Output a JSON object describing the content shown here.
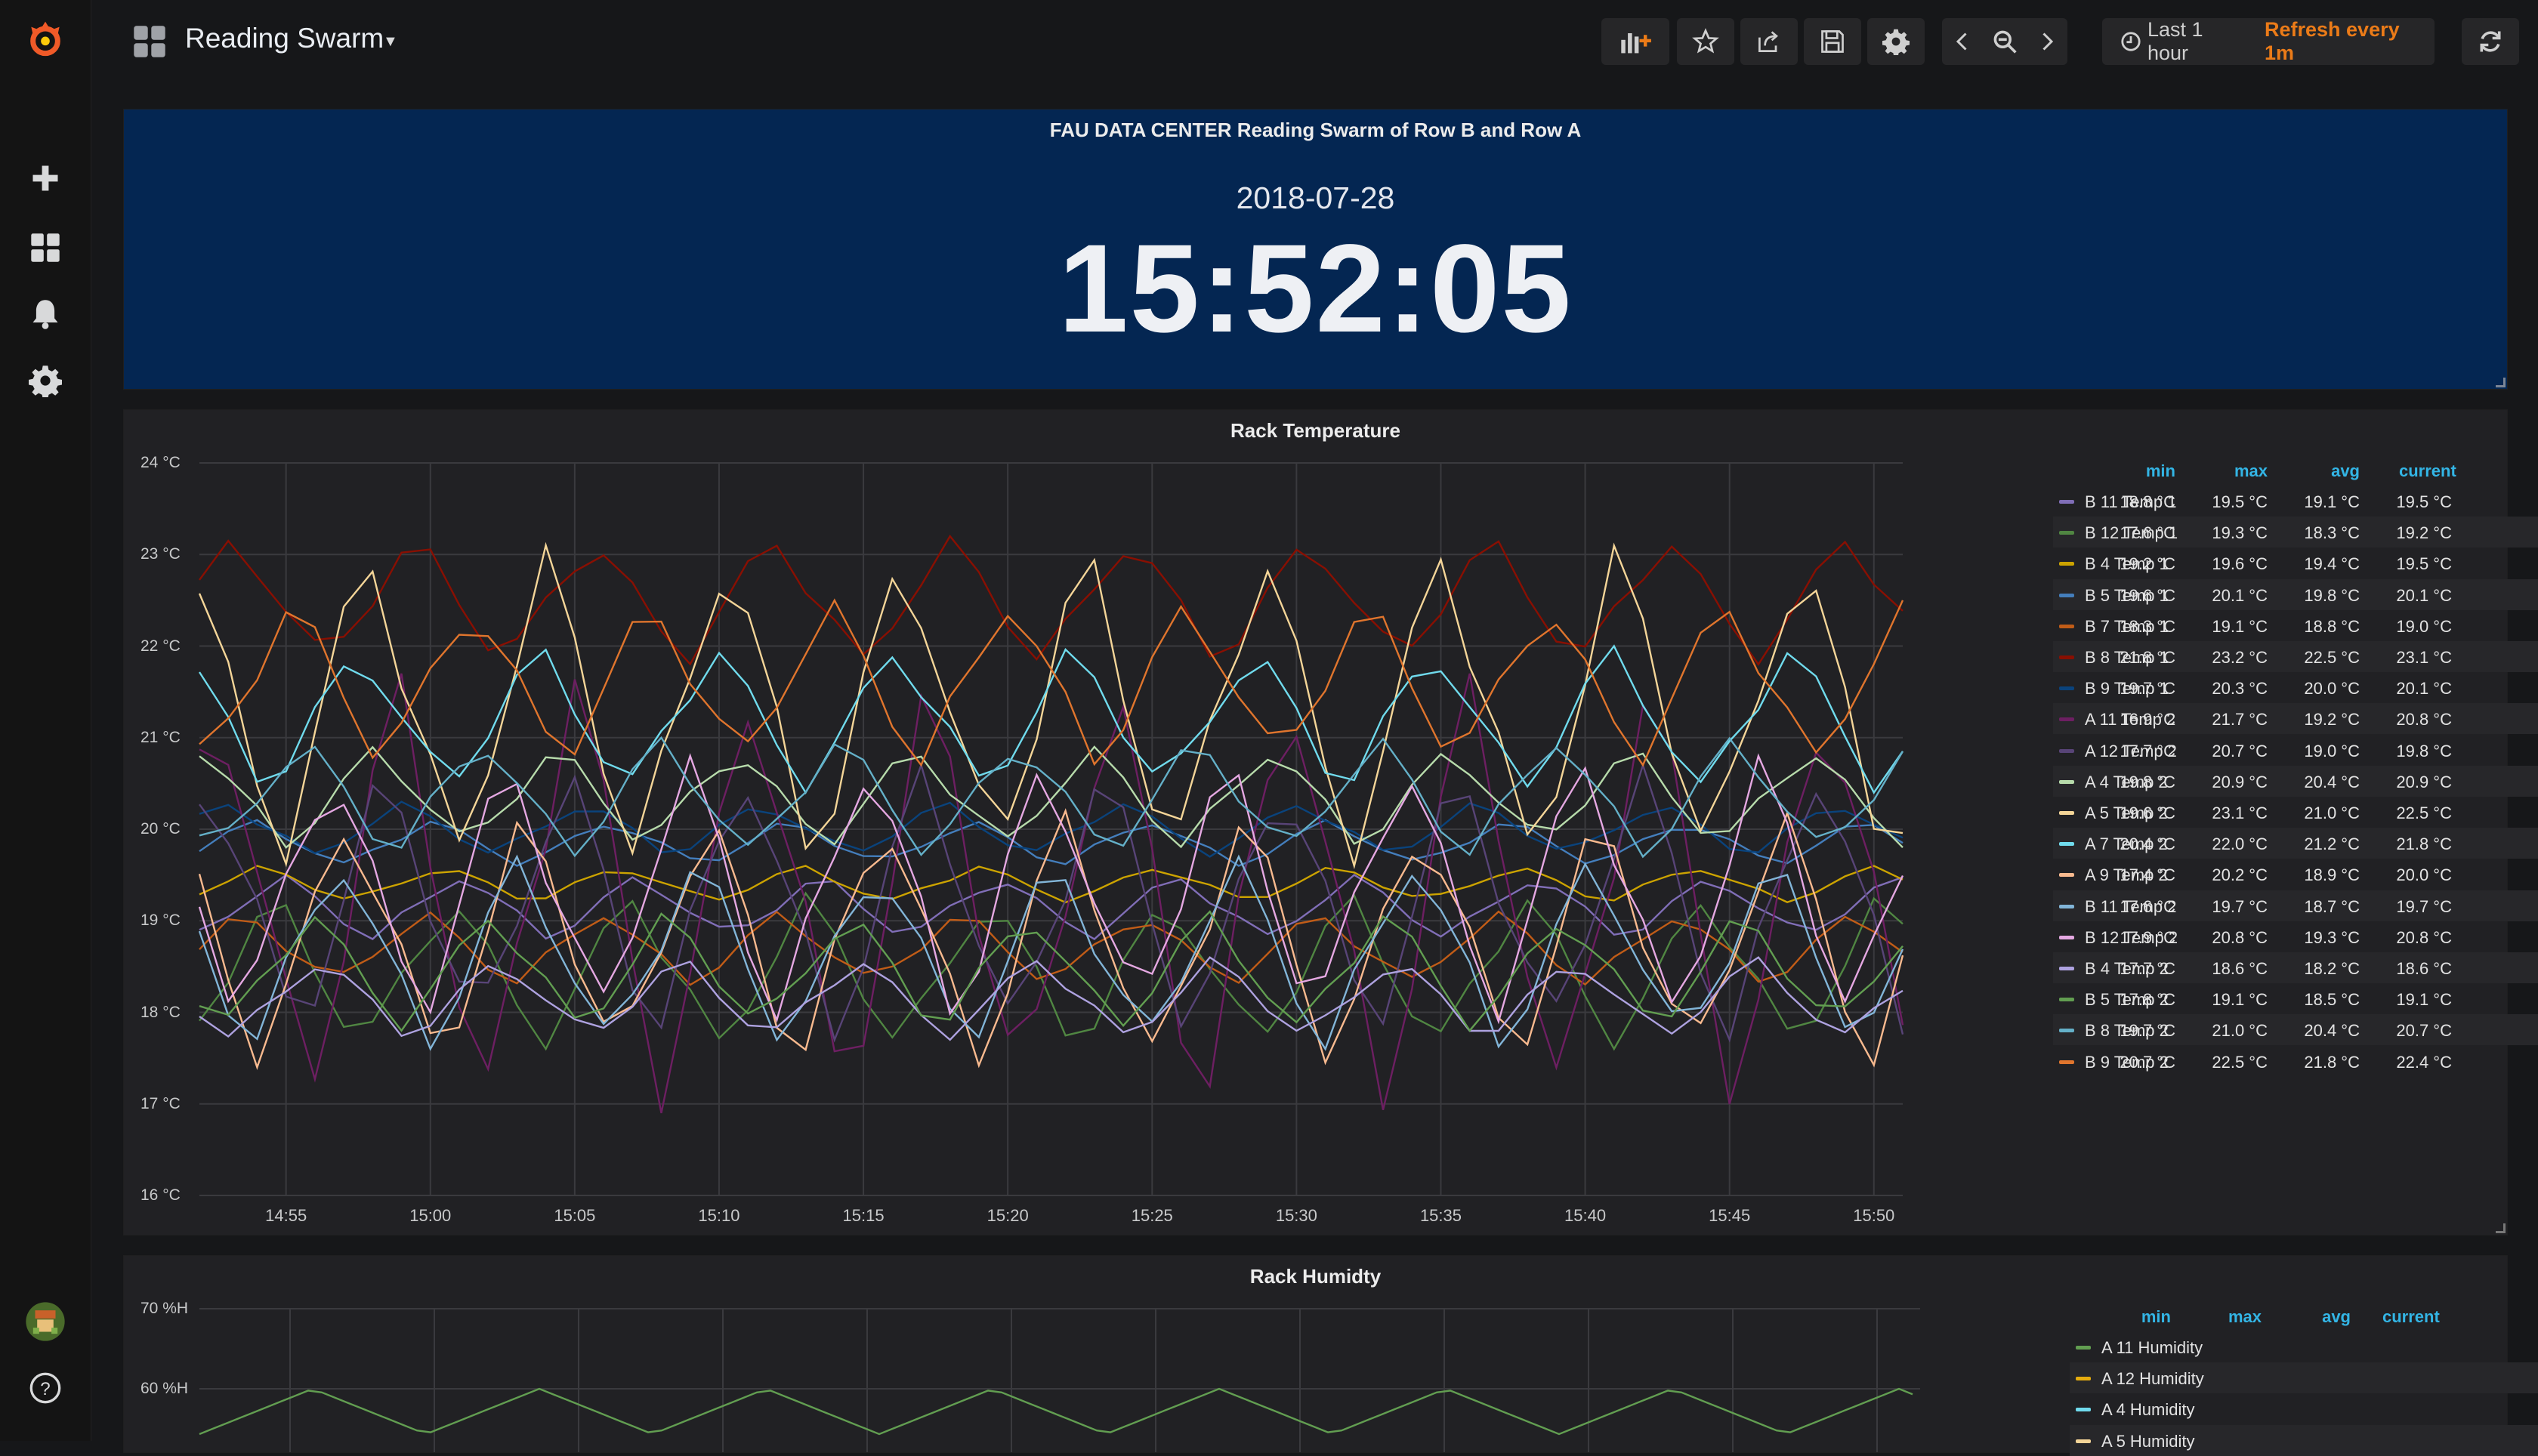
{
  "dashboard": {
    "title": "Reading Swarm"
  },
  "time_picker": {
    "range": "Last 1 hour",
    "refresh": "Refresh every 1m"
  },
  "clock_panel": {
    "title": "FAU DATA CENTER Reading Swarm of Row B and Row A",
    "date": "2018-07-28",
    "time": "15:52:05",
    "background": "#042652"
  },
  "colors": {
    "accent": "#33b5e5",
    "refresh": "#eb7b18",
    "panel": "#212124",
    "logo": "#f05a28"
  },
  "icons": {
    "side": [
      "grafana-logo-icon",
      "plus-icon",
      "dashboards-icon",
      "bell-icon",
      "gear-icon",
      "avatar",
      "help-icon"
    ],
    "nav": [
      "add-panel-icon",
      "star-icon",
      "share-icon",
      "save-icon",
      "gear-icon",
      "chevron-left-icon",
      "zoom-out-icon",
      "chevron-right-icon",
      "clock-icon",
      "refresh-icon"
    ]
  },
  "temp_panel": {
    "title": "Rack Temperature",
    "legend_columns": [
      "min",
      "max",
      "avg",
      "current"
    ],
    "chart_data": {
      "type": "line",
      "title": "Rack Temperature",
      "ylim": [
        16,
        24
      ],
      "y_ticks": [
        "16 °C",
        "17 °C",
        "18 °C",
        "19 °C",
        "20 °C",
        "21 °C",
        "22 °C",
        "23 °C",
        "24 °C"
      ],
      "x_ticks": [
        "14:55",
        "15:00",
        "15:05",
        "15:10",
        "15:15",
        "15:20",
        "15:25",
        "15:30",
        "15:35",
        "15:40",
        "15:45",
        "15:50"
      ],
      "x_range": [
        "14:52",
        "15:51"
      ],
      "grid": true,
      "legend_placement": "right",
      "series": [
        {
          "name": "B 11 Temp 1",
          "color": "#806eb7",
          "min": "18.8 °C",
          "max": "19.5 °C",
          "avg": "19.1 °C",
          "current": "19.5 °C",
          "lo": 18.8,
          "hi": 19.5,
          "phase": 0.3
        },
        {
          "name": "B 12 Temp 1",
          "color": "#508642",
          "min": "17.6 °C",
          "max": "19.3 °C",
          "avg": "18.3 °C",
          "current": "19.2 °C",
          "lo": 17.6,
          "hi": 19.3,
          "phase": 0.7
        },
        {
          "name": "B 4 Temp 1",
          "color": "#cca300",
          "min": "19.2 °C",
          "max": "19.6 °C",
          "avg": "19.4 °C",
          "current": "19.5 °C",
          "lo": 19.2,
          "hi": 19.6,
          "phase": 1.1
        },
        {
          "name": "B 5 Temp 1",
          "color": "#447ebc",
          "min": "19.6 °C",
          "max": "20.1 °C",
          "avg": "19.8 °C",
          "current": "20.1 °C",
          "lo": 19.6,
          "hi": 20.1,
          "phase": 1.5
        },
        {
          "name": "B 7 Temp 1",
          "color": "#c15c17",
          "min": "18.3 °C",
          "max": "19.1 °C",
          "avg": "18.8 °C",
          "current": "19.0 °C",
          "lo": 18.3,
          "hi": 19.1,
          "phase": 1.9
        },
        {
          "name": "B 8 Temp 1",
          "color": "#890f02",
          "min": "21.8 °C",
          "max": "23.2 °C",
          "avg": "22.5 °C",
          "current": "23.1 °C",
          "lo": 21.8,
          "hi": 23.2,
          "phase": 2.3
        },
        {
          "name": "B 9 Temp 1",
          "color": "#0a437c",
          "min": "19.7 °C",
          "max": "20.3 °C",
          "avg": "20.0 °C",
          "current": "20.1 °C",
          "lo": 19.7,
          "hi": 20.3,
          "phase": 2.7
        },
        {
          "name": "A 11 Temp 2",
          "color": "#6d1f62",
          "min": "16.9 °C",
          "max": "21.7 °C",
          "avg": "19.2 °C",
          "current": "20.8 °C",
          "lo": 16.9,
          "hi": 21.7,
          "phase": 3.1
        },
        {
          "name": "A 12 Temp 2",
          "color": "#584477",
          "min": "17.7 °C",
          "max": "20.7 °C",
          "avg": "19.0 °C",
          "current": "19.8 °C",
          "lo": 17.7,
          "hi": 20.7,
          "phase": 3.5
        },
        {
          "name": "A 4 Temp 2",
          "color": "#b7dbab",
          "min": "19.8 °C",
          "max": "20.9 °C",
          "avg": "20.4 °C",
          "current": "20.9 °C",
          "lo": 19.8,
          "hi": 20.9,
          "phase": 3.9
        },
        {
          "name": "A 5 Temp 2",
          "color": "#f4d598",
          "min": "19.6 °C",
          "max": "23.1 °C",
          "avg": "21.0 °C",
          "current": "22.5 °C",
          "lo": 19.6,
          "hi": 23.1,
          "phase": 4.3
        },
        {
          "name": "A 7 Temp 2",
          "color": "#70dbed",
          "min": "20.4 °C",
          "max": "22.0 °C",
          "avg": "21.2 °C",
          "current": "21.8 °C",
          "lo": 20.4,
          "hi": 22.0,
          "phase": 4.7
        },
        {
          "name": "A 9 Temp 2",
          "color": "#f9ba8f",
          "min": "17.4 °C",
          "max": "20.2 °C",
          "avg": "18.9 °C",
          "current": "20.0 °C",
          "lo": 17.4,
          "hi": 20.2,
          "phase": 5.1
        },
        {
          "name": "B 11 Temp 2",
          "color": "#82b5d8",
          "min": "17.6 °C",
          "max": "19.7 °C",
          "avg": "18.7 °C",
          "current": "19.7 °C",
          "lo": 17.6,
          "hi": 19.7,
          "phase": 5.5
        },
        {
          "name": "B 12 Temp 2",
          "color": "#e5a8e2",
          "min": "17.9 °C",
          "max": "20.8 °C",
          "avg": "19.3 °C",
          "current": "20.8 °C",
          "lo": 17.9,
          "hi": 20.8,
          "phase": 5.9
        },
        {
          "name": "B 4 Temp 2",
          "color": "#aea2e0",
          "min": "17.7 °C",
          "max": "18.6 °C",
          "avg": "18.2 °C",
          "current": "18.6 °C",
          "lo": 17.7,
          "hi": 18.6,
          "phase": 6.3
        },
        {
          "name": "B 5 Temp 2",
          "color": "#629e51",
          "min": "17.8 °C",
          "max": "19.1 °C",
          "avg": "18.5 °C",
          "current": "19.1 °C",
          "lo": 17.8,
          "hi": 19.1,
          "phase": 6.7
        },
        {
          "name": "B 8 Temp 2",
          "color": "#64b0c8",
          "min": "19.7 °C",
          "max": "21.0 °C",
          "avg": "20.4 °C",
          "current": "20.7 °C",
          "lo": 19.7,
          "hi": 21.0,
          "phase": 7.1
        },
        {
          "name": "B 9 Temp 2",
          "color": "#e0752d",
          "min": "20.7 °C",
          "max": "22.5 °C",
          "avg": "21.8 °C",
          "current": "22.4 °C",
          "lo": 20.7,
          "hi": 22.5,
          "phase": 7.5
        }
      ]
    }
  },
  "humidity_panel": {
    "title": "Rack Humidty",
    "legend_columns": [
      "min",
      "max",
      "avg",
      "current"
    ],
    "chart_data": {
      "type": "line",
      "title": "Rack Humidty",
      "y_ticks": [
        "60 %H",
        "70 %H"
      ],
      "grid": true,
      "legend_placement": "right",
      "series": [
        {
          "name": "A 11 Humidity",
          "color": "#629e51"
        },
        {
          "name": "A 12 Humidity",
          "color": "#e5ac0e"
        },
        {
          "name": "A 4 Humidity",
          "color": "#70dbed"
        },
        {
          "name": "A 5 Humidity",
          "color": "#f4d598"
        }
      ]
    }
  }
}
